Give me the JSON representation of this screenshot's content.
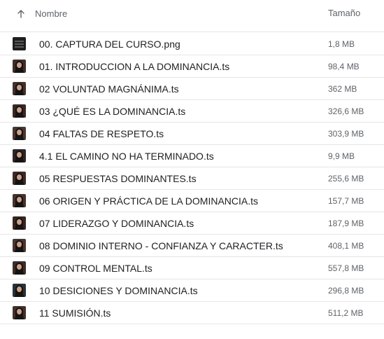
{
  "header": {
    "name_label": "Nombre",
    "size_label": "Tamaño",
    "sort_icon": "arrow-up-icon"
  },
  "files": [
    {
      "name": "00. CAPTURA DEL CURSO.png",
      "size": "1,8 MB",
      "icon": "image-thumbnail"
    },
    {
      "name": "01. INTRODUCCION A LA DOMINANCIA.ts",
      "size": "98,4 MB",
      "icon": "video-thumbnail"
    },
    {
      "name": "02 VOLUNTAD MAGNÁNIMA.ts",
      "size": "362 MB",
      "icon": "video-thumbnail"
    },
    {
      "name": "03 ¿QUÉ ES LA DOMINANCIA.ts",
      "size": "326,6 MB",
      "icon": "video-thumbnail"
    },
    {
      "name": "04 FALTAS DE RESPETO.ts",
      "size": "303,9 MB",
      "icon": "video-thumbnail"
    },
    {
      "name": "4.1 EL CAMINO NO HA TERMINADO.ts",
      "size": "9,9 MB",
      "icon": "video-thumbnail"
    },
    {
      "name": "05 RESPUESTAS DOMINANTES.ts",
      "size": "255,6 MB",
      "icon": "video-thumbnail"
    },
    {
      "name": "06 ORIGEN Y PRÁCTICA DE LA DOMINANCIA.ts",
      "size": "157,7 MB",
      "icon": "video-thumbnail"
    },
    {
      "name": "07 LIDERAZGO Y DOMINANCIA.ts",
      "size": "187,9 MB",
      "icon": "video-thumbnail"
    },
    {
      "name": "08 DOMINIO INTERNO - CONFIANZA Y CARACTER.ts",
      "size": "408,1 MB",
      "icon": "video-thumbnail"
    },
    {
      "name": "09 CONTROL MENTAL.ts",
      "size": "557,8 MB",
      "icon": "video-thumbnail"
    },
    {
      "name": "10 DESICIONES Y DOMINANCIA.ts",
      "size": "296,8 MB",
      "icon": "video-thumbnail"
    },
    {
      "name": "11 SUMISIÓN.ts",
      "size": "511,2 MB",
      "icon": "video-thumbnail"
    }
  ]
}
